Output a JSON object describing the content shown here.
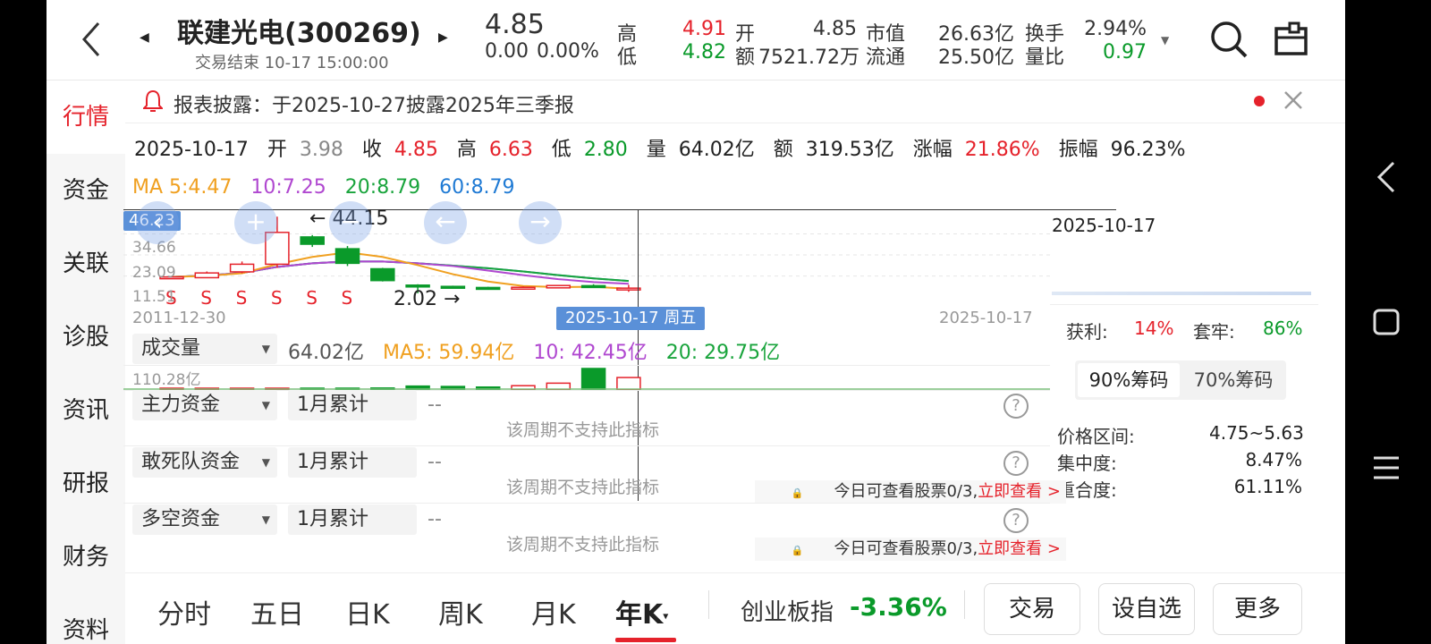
{
  "header": {
    "stock_name": "联建光电(300269)",
    "status": "交易结束 10-17 15:00:00",
    "price": "4.85",
    "change": "0.00",
    "change_pct": "0.00%",
    "high_label": "高",
    "high": "4.91",
    "low_label": "低",
    "low": "4.82",
    "open_label": "开",
    "open": "4.85",
    "amount_label": "额",
    "amount": "7521.72万",
    "mcap_label": "市值",
    "mcap": "26.63亿",
    "float_label": "流通",
    "float": "25.50亿",
    "turnover_label": "换手",
    "turnover": "2.94%",
    "volratio_label": "量比",
    "volratio": "0.97"
  },
  "nav": [
    "行情",
    "资金",
    "关联",
    "诊股",
    "资讯",
    "研报",
    "财务",
    "资料"
  ],
  "notice": {
    "text": "报表披露：于2025-10-27披露2025年三季报"
  },
  "ohlc_bar": {
    "date": "2025-10-17",
    "open_label": "开",
    "open": "3.98",
    "close_label": "收",
    "close": "4.85",
    "high_label": "高",
    "high": "6.63",
    "low_label": "低",
    "low": "2.80",
    "vol_label": "量",
    "vol": "64.02亿",
    "amt_label": "额",
    "amt": "319.53亿",
    "chg_label": "涨幅",
    "chg": "21.86%",
    "amp_label": "振幅",
    "amp": "96.23%"
  },
  "ma": {
    "ma5": "MA 5:4.47",
    "ma10": "10:7.25",
    "ma20": "20:8.79",
    "ma60": "60:8.79"
  },
  "kchart": {
    "y_ticks": [
      "46.23",
      "34.66",
      "23.09",
      "11.51"
    ],
    "max_label": "44.15",
    "min_label": "2.02",
    "start_date": "2011-12-30",
    "end_date": "2025-10-17",
    "cursor_label": "2025-10-17 周五",
    "right_date": "2025-10-17"
  },
  "volume": {
    "selector": "成交量",
    "vol": "64.02亿",
    "ma5": "MA5: 59.94亿",
    "ma10": "10: 42.45亿",
    "ma20": "20: 29.75亿",
    "max": "110.28亿"
  },
  "indicators": [
    {
      "name": "主力资金",
      "period": "1月累计",
      "value": "--",
      "msg": "该周期不支持此指标"
    },
    {
      "name": "敢死队资金",
      "period": "1月累计",
      "value": "--",
      "msg": "该周期不支持此指标",
      "tip": "今日可查看股票0/3,",
      "tip_link": "立即查看 >"
    },
    {
      "name": "多空资金",
      "period": "1月累计",
      "value": "--",
      "msg": "该周期不支持此指标",
      "tip": "今日可查看股票0/3,",
      "tip_link": "立即查看 >"
    }
  ],
  "chips": {
    "profit_label": "获利:",
    "profit": "14%",
    "trapped_label": "套牢:",
    "trapped": "86%",
    "tab90": "90%筹码",
    "tab70": "70%筹码",
    "range_label": "价格区间:",
    "range": "4.75~5.63",
    "conc_label": "集中度:",
    "conc": "8.47%",
    "overlap_label": "重合度:",
    "overlap": "61.11%"
  },
  "tabs": [
    "分时",
    "五日",
    "日K",
    "周K",
    "月K",
    "年K"
  ],
  "index": {
    "name": "创业板指",
    "value": "-3.36%"
  },
  "buttons": {
    "trade": "交易",
    "watch": "设自选",
    "more": "更多"
  },
  "colors": {
    "up": "#e5222b",
    "down": "#0a9a2a",
    "accent_blue": "#5a90d8"
  },
  "candles": [
    {
      "o": 11.0,
      "c": 11.0,
      "h": 11.6,
      "l": 10.8
    },
    {
      "o": 10.6,
      "c": 13.2,
      "h": 14.0,
      "l": 10.4
    },
    {
      "o": 13.8,
      "c": 18.0,
      "h": 19.5,
      "l": 13.0
    },
    {
      "o": 18.0,
      "c": 35.5,
      "h": 44.15,
      "l": 16.0
    },
    {
      "o": 33.0,
      "c": 29.0,
      "h": 34.0,
      "l": 27.5
    },
    {
      "o": 26.5,
      "c": 18.5,
      "h": 28.0,
      "l": 17.0
    },
    {
      "o": 15.5,
      "c": 9.0,
      "h": 16.0,
      "l": 8.5
    },
    {
      "o": 6.5,
      "c": 5.8,
      "h": 7.0,
      "l": 2.02
    },
    {
      "o": 5.8,
      "c": 5.4,
      "h": 6.2,
      "l": 5.0
    },
    {
      "o": 5.2,
      "c": 5.0,
      "h": 5.6,
      "l": 4.7
    },
    {
      "o": 4.9,
      "c": 5.3,
      "h": 5.8,
      "l": 4.7
    },
    {
      "o": 5.0,
      "c": 6.3,
      "h": 6.6,
      "l": 4.8
    },
    {
      "o": 6.2,
      "c": 5.8,
      "h": 7.0,
      "l": 5.6
    },
    {
      "o": 3.98,
      "c": 4.85,
      "h": 6.63,
      "l": 2.8
    }
  ],
  "volumes": [
    4,
    5,
    6,
    9,
    7,
    6,
    10,
    20,
    18,
    15,
    22,
    35,
    110.28,
    64.02
  ],
  "ma_lines": {
    "ma5": [
      11.0,
      11.6,
      13.0,
      18.0,
      22.0,
      24.5,
      22.0,
      17.5,
      12.5,
      8.5,
      6.0,
      5.4,
      5.6,
      4.47
    ],
    "ma10": [
      11.0,
      11.8,
      13.2,
      16.5,
      18.5,
      19.5,
      19.5,
      18.5,
      17.0,
      14.5,
      12.0,
      9.8,
      8.2,
      7.25
    ],
    "ma20": [
      11.0,
      11.8,
      13.2,
      16.5,
      18.5,
      19.5,
      19.5,
      18.5,
      17.2,
      15.8,
      14.0,
      12.0,
      10.2,
      8.79
    ],
    "ma60": [
      11.0,
      11.8,
      13.2,
      16.5,
      18.5,
      19.5,
      19.5,
      18.5,
      17.2,
      15.8,
      14.0,
      12.0,
      10.2,
      8.79
    ]
  }
}
